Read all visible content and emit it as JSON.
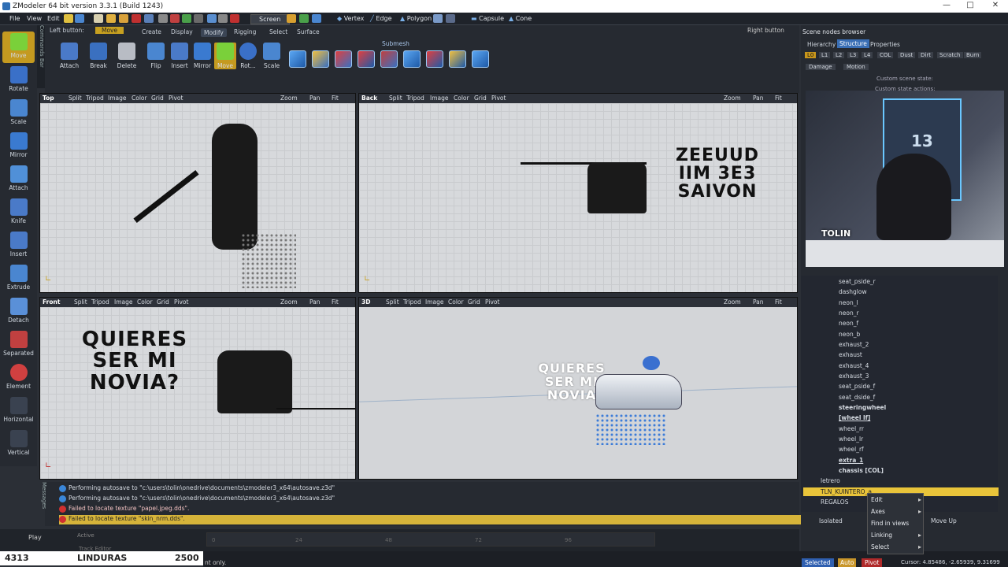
{
  "window": {
    "title": "ZModeler 64 bit version 3.3.1 (Build 1243)"
  },
  "menu": {
    "file": "File",
    "view": "View",
    "edit": "Edit",
    "screen": "Screen",
    "vertex": "Vertex",
    "edge": "Edge",
    "polygon": "Polygon",
    "capsule": "Capsule",
    "cone": "Cone"
  },
  "tools": [
    "Move",
    "Rotate",
    "Scale",
    "Mirror",
    "Attach",
    "Knife",
    "Insert",
    "Extrude",
    "Detach",
    "Separated",
    "Element",
    "Horizontal",
    "Vertical"
  ],
  "commands_label": "Commands Bar",
  "ribbon": {
    "left_button": "Left button:",
    "active_tool": "Move",
    "tabs": [
      "Create",
      "Display",
      "Modify",
      "Rigging",
      "Select",
      "Surface"
    ],
    "submesh": "Submesh",
    "buttons": [
      "Attach",
      "Break",
      "Delete",
      "Flip",
      "Insert",
      "Mirror",
      "Move",
      "Rot...",
      "Scale"
    ]
  },
  "viewports": {
    "menu": [
      "Split",
      "Tripod",
      "Image",
      "Color",
      "Grid",
      "Pivot"
    ],
    "zoom": "Zoom",
    "pan": "Pan",
    "fit": "Fit",
    "names": [
      "Top",
      "Back",
      "Front",
      "3D"
    ]
  },
  "scene_texts": {
    "back": [
      "ZEEUUD",
      "IIM 3E3",
      "SAIVON"
    ],
    "front": [
      "QUIERES",
      "SER MI",
      "NOVIA?"
    ],
    "3d": [
      "QUIERES",
      "SER MI",
      "NOVIA"
    ]
  },
  "webcam": {
    "badge_number": "13",
    "overlay": "TOLIN"
  },
  "right_button": "Right button",
  "scene_browser": {
    "title": "Scene nodes browser",
    "tabs": [
      "Hierarchy",
      "Structure",
      "Properties"
    ],
    "lod_buttons": [
      "L0",
      "L1",
      "L2",
      "L3",
      "L4",
      "COL",
      "Dust",
      "Dirt",
      "Scratch",
      "Burn"
    ],
    "dropdowns": [
      "Damage",
      "Motion"
    ],
    "custom_state": "Custom scene state:",
    "custom_actions": "Custom state actions:",
    "nodes": [
      "seat_pside_r",
      "dashglow",
      "neon_l",
      "neon_r",
      "neon_f",
      "neon_b",
      "exhaust_2",
      "exhaust",
      "exhaust_4",
      "exhaust_3",
      "seat_pside_f",
      "seat_dside_f",
      "steeringwheel",
      "[wheel lf]",
      "wheel_rr",
      "wheel_lr",
      "wheel_rf",
      "extra_1",
      "chassis [COL]"
    ],
    "top_nodes": [
      "letrero",
      "TLN_KUINTERO_a",
      "REGALOS"
    ],
    "footer": {
      "isolated": "Isolated",
      "move_up": "Move Up"
    }
  },
  "context_menu": [
    "Edit",
    "Axes",
    "Find in views",
    "Linking",
    "Select"
  ],
  "messages": [
    {
      "type": "info",
      "text": "Performing autosave to \"c:\\users\\tolin\\onedrive\\documents\\zmodeler3_x64\\autosave.z3d\""
    },
    {
      "type": "info",
      "text": "Performing autosave to \"c:\\users\\tolin\\onedrive\\documents\\zmodeler3_x64\\autosave.z3d\""
    },
    {
      "type": "error",
      "text": "Failed to locate texture \"papel.jpeg.dds\"."
    },
    {
      "type": "error",
      "text": "Failed to locate texture \"skin_nrm.dds\"."
    }
  ],
  "messages_label": "Messages",
  "timeline": {
    "play": "Play",
    "active": "Active",
    "track_editor": "Track Editor",
    "ticks": [
      "0",
      "24",
      "48",
      "72",
      "96"
    ]
  },
  "overlay_bar": {
    "left_value": "4313",
    "title": "LINDURAS",
    "right_value": "2500"
  },
  "status": {
    "partial": "nt only.",
    "selected": "Selected",
    "auto": "Auto",
    "pivot": "Pivot",
    "cursor": "Cursor: 4.85486, -2.65939, 9.31699"
  },
  "colors": {
    "accent_green": "#6fbf2a",
    "highlight_yellow": "#e9c43a",
    "ribbon_active": "#6fbf2a"
  }
}
